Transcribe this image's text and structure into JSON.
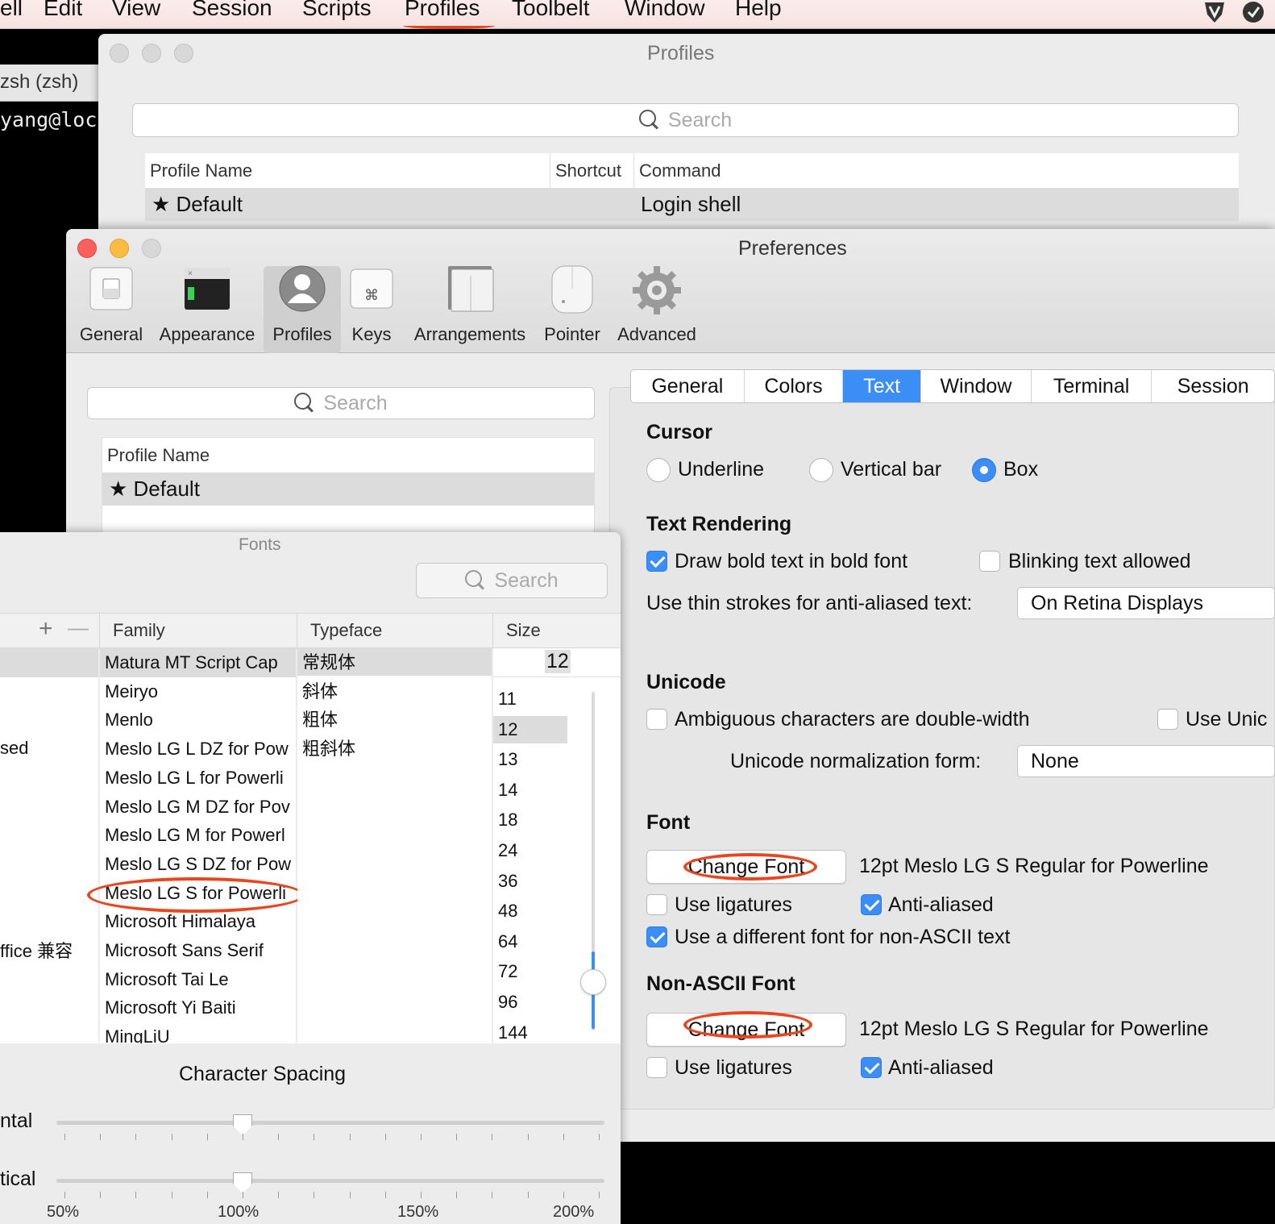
{
  "menubar": {
    "items": [
      "ell",
      "Edit",
      "View",
      "Session",
      "Scripts",
      "Profiles",
      "Toolbelt",
      "Window",
      "Help"
    ]
  },
  "terminal": {
    "tab_title": "zsh (zsh)",
    "prompt": "yang@loca"
  },
  "profiles_window": {
    "title": "Profiles",
    "search_placeholder": "Search",
    "columns": [
      "Profile Name",
      "Shortcut",
      "Command"
    ],
    "row": {
      "name": "★ Default",
      "shortcut": "",
      "command": "Login shell"
    }
  },
  "preferences": {
    "title": "Preferences",
    "toolbar": [
      "General",
      "Appearance",
      "Profiles",
      "Keys",
      "Arrangements",
      "Pointer",
      "Advanced"
    ],
    "selected_toolbar": "Profiles",
    "profile_search_placeholder": "Search",
    "profile_list_header": "Profile Name",
    "profile_list": [
      "★ Default"
    ],
    "tabs": [
      "General",
      "Colors",
      "Text",
      "Window",
      "Terminal",
      "Session"
    ],
    "active_tab": "Text",
    "cursor": {
      "title": "Cursor",
      "options": [
        "Underline",
        "Vertical bar",
        "Box"
      ],
      "selected": "Box"
    },
    "text_rendering": {
      "title": "Text Rendering",
      "bold_label": "Draw bold text in bold font",
      "bold_checked": true,
      "blink_label": "Blinking text allowed",
      "blink_checked": false,
      "thin_label": "Use thin strokes for anti-aliased text:",
      "thin_value": "On Retina Displays"
    },
    "unicode": {
      "title": "Unicode",
      "ambiguous_label": "Ambiguous characters are double-width",
      "ambiguous_checked": false,
      "use_uni_label": "Use Unic",
      "normalization_label": "Unicode normalization form:",
      "normalization_value": "None"
    },
    "font": {
      "title": "Font",
      "button": "Change Font",
      "value": "12pt Meslo LG S Regular for Powerline",
      "ligatures_label": "Use ligatures",
      "ligatures_checked": false,
      "antialiased_label": "Anti-aliased",
      "antialiased_checked": true,
      "nonascii_label": "Use a different font for non-ASCII text",
      "nonascii_checked": true
    },
    "non_ascii_font": {
      "title": "Non-ASCII Font",
      "button": "Change Font",
      "value": "12pt Meslo LG S Regular for Powerline",
      "ligatures_label": "Use ligatures",
      "ligatures_checked": false,
      "antialiased_label": "Anti-aliased",
      "antialiased_checked": true
    }
  },
  "fonts_panel": {
    "title": "Fonts",
    "search_placeholder": "Search",
    "collection_add": "+",
    "collection_remove": "—",
    "columns": {
      "family": "Family",
      "typeface": "Typeface",
      "size": "Size"
    },
    "collections_partial": [
      "sed",
      "ffice 兼容"
    ],
    "families": [
      "Matura MT Script Cap",
      "Meiryo",
      "Menlo",
      "Meslo LG L DZ for Pow",
      "Meslo LG L for Powerli",
      "Meslo LG M DZ for Pov",
      "Meslo LG M for Powerl",
      "Meslo LG S DZ for Pow",
      "Meslo LG S for Powerli",
      "Microsoft Himalaya",
      "Microsoft Sans Serif",
      "Microsoft Tai Le",
      "Microsoft Yi Baiti",
      "MingLiU"
    ],
    "selected_family": "Meslo LG S for Powerli",
    "typefaces": [
      "常规体",
      "斜体",
      "粗体",
      "粗斜体"
    ],
    "selected_typeface": "常规体",
    "size_value": "12",
    "sizes": [
      "11",
      "12",
      "13",
      "14",
      "18",
      "24",
      "36",
      "48",
      "64",
      "72",
      "96",
      "144"
    ],
    "selected_size": "12",
    "character_spacing": {
      "title": "Character Spacing",
      "horizontal_label": "ntal",
      "vertical_label": "tical",
      "horizontal_value_pct": 100,
      "vertical_value_pct": 100,
      "scale": [
        "50%",
        "100%",
        "150%",
        "200%"
      ]
    }
  },
  "colors": {
    "accent": "#3a8ef6",
    "annotation": "#e8461f"
  }
}
